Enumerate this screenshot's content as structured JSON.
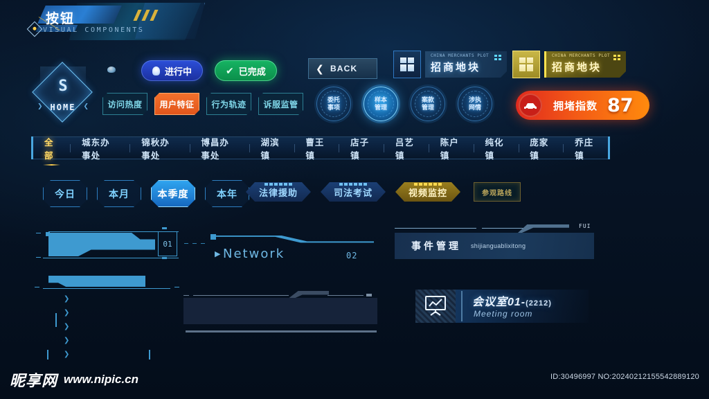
{
  "banner": {
    "title": "按钮",
    "subtitle": "VISUAL COMPONENTS"
  },
  "home_badge": {
    "glyph": "S",
    "label": "HOME",
    "arrow_left": "❯",
    "arrow_right": "❮"
  },
  "tag_buttons": [
    {
      "label": "访问热度",
      "active": false
    },
    {
      "label": "用户特征",
      "active": true
    },
    {
      "label": "行为轨迹",
      "active": false
    },
    {
      "label": "诉服监管",
      "active": false
    }
  ],
  "status_pills": [
    {
      "label": "进行中",
      "icon": "bulb-icon",
      "color": "#2c4fd8"
    },
    {
      "label": "已完成",
      "icon": "check-icon",
      "color": "#16b463"
    }
  ],
  "back_button": {
    "label": "BACK",
    "icon": "chevron-left-icon"
  },
  "plot_cards": [
    {
      "en": "CHINA MERCHANTS PLOT",
      "cn": "招商地块",
      "theme": "blue"
    },
    {
      "en": "CHINA MERCHANTS PLOT",
      "cn": "招商地块",
      "theme": "gold"
    }
  ],
  "circle_buttons": [
    {
      "line1": "委托",
      "line2": "事项",
      "active": false
    },
    {
      "line1": "样本",
      "line2": "管理",
      "active": true
    },
    {
      "line1": "案款",
      "line2": "管理",
      "active": false
    },
    {
      "line1": "涉执",
      "line2": "网情",
      "active": false
    }
  ],
  "congestion": {
    "label": "拥堵指数",
    "value": "87",
    "icon": "car-icon"
  },
  "nav": {
    "items": [
      {
        "label": "全部",
        "active": true
      },
      {
        "label": "城东办事处",
        "active": false
      },
      {
        "label": "锦秋办事处",
        "active": false
      },
      {
        "label": "博昌办事处",
        "active": false
      },
      {
        "label": "湖滨镇",
        "active": false
      },
      {
        "label": "曹王镇",
        "active": false
      },
      {
        "label": "店子镇",
        "active": false
      },
      {
        "label": "吕艺镇",
        "active": false
      },
      {
        "label": "陈户镇",
        "active": false
      },
      {
        "label": "纯化镇",
        "active": false
      },
      {
        "label": "庞家镇",
        "active": false
      },
      {
        "label": "乔庄镇",
        "active": false
      }
    ]
  },
  "time_filters": [
    {
      "label": "今日",
      "active": false
    },
    {
      "label": "本月",
      "active": false
    },
    {
      "label": "本季度",
      "active": true
    },
    {
      "label": "本年",
      "active": false
    }
  ],
  "hex_buttons": [
    {
      "label": "法律援助",
      "theme": "blue"
    },
    {
      "label": "司法考试",
      "theme": "blue"
    },
    {
      "label": "视频监控",
      "theme": "gold"
    }
  ],
  "route_button": {
    "label": "参观路线"
  },
  "hud": {
    "bar_index_01": "01",
    "network_label": "Network",
    "network_index": "02",
    "event_card": {
      "cn": "事件管理",
      "pinyin": "shijianguablixitong",
      "corner_label": "FUI"
    },
    "meeting": {
      "cn": "会议室01-",
      "code": "(2212)",
      "en": "Meeting room",
      "icon": "presentation-board-icon"
    }
  },
  "footer": {
    "watermark_cn": "昵享网",
    "watermark_url": "www.nipic.cn",
    "id_text": "ID:30496997 NO:20240212155542889120"
  },
  "colors": {
    "accent_blue": "#3e9ad0",
    "accent_gold": "#ffcf4d",
    "accent_orange": "#f4712c",
    "accent_green": "#16b463",
    "accent_red": "#e02a1e"
  }
}
